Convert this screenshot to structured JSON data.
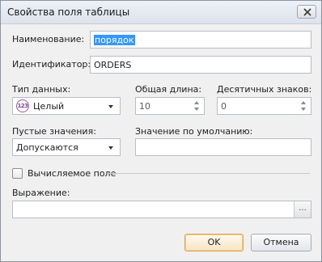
{
  "window": {
    "title": "Свойства поля таблицы"
  },
  "fields": {
    "name": {
      "label": "Наименование:",
      "value": "порядок"
    },
    "identifier": {
      "label": "Идентификатор:",
      "value": "ORDERS"
    },
    "data_type": {
      "label": "Тип данных:",
      "value": "Целый",
      "icon_text": "123",
      "icon": "integer-type-icon"
    },
    "total_length": {
      "label": "Общая длина:",
      "value": "10"
    },
    "decimals": {
      "label": "Десятичных знаков:",
      "value": "0"
    },
    "nulls": {
      "label": "Пустые значения:",
      "value": "Допускаются"
    },
    "default": {
      "label": "Значение по умолчанию:",
      "value": ""
    },
    "computed": {
      "label": "Вычисляемое поле",
      "checked": false
    },
    "expression": {
      "label": "Выражение:",
      "value": "",
      "button_label": "..."
    }
  },
  "buttons": {
    "ok": "OK",
    "cancel": "Отмена"
  },
  "colors": {
    "selection": "#3399ff",
    "default_button_border": "#e0a34a"
  }
}
